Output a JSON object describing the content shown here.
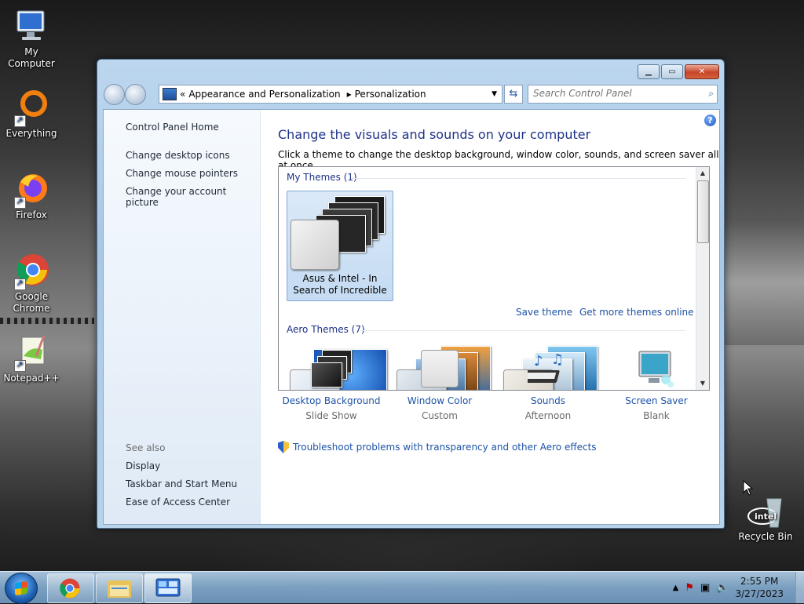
{
  "desktop": {
    "icons": [
      {
        "label": "My Computer"
      },
      {
        "label": "Everything"
      },
      {
        "label": "Firefox"
      },
      {
        "label": "Google Chrome"
      },
      {
        "label": "Notepad++"
      },
      {
        "label": "Recycle Bin"
      }
    ]
  },
  "window": {
    "address": {
      "sep": "«",
      "segments": [
        "Appearance and Personalization",
        "Personalization"
      ],
      "nav_sep": "▸"
    },
    "search": {
      "placeholder": "Search Control Panel"
    },
    "left": {
      "home": "Control Panel Home",
      "tasks": [
        "Change desktop icons",
        "Change mouse pointers",
        "Change your account picture"
      ],
      "see_also_heading": "See also",
      "see_also": [
        "Display",
        "Taskbar and Start Menu",
        "Ease of Access Center"
      ]
    },
    "main": {
      "heading": "Change the visuals and sounds on your computer",
      "description": "Click a theme to change the desktop background, window color, sounds, and screen saver all at once.",
      "my_themes_header": "My Themes (1)",
      "my_theme_name_line1": "Asus & Intel - In",
      "my_theme_name_line2": "Search of Incredible",
      "save_theme": "Save theme",
      "get_more": "Get more themes online",
      "aero_themes_header": "Aero Themes (7)",
      "bottom": [
        {
          "title": "Desktop Background",
          "subtitle": "Slide Show"
        },
        {
          "title": "Window Color",
          "subtitle": "Custom"
        },
        {
          "title": "Sounds",
          "subtitle": "Afternoon"
        },
        {
          "title": "Screen Saver",
          "subtitle": "Blank"
        }
      ],
      "troubleshoot": "Troubleshoot problems with transparency and other Aero effects"
    }
  },
  "taskbar": {
    "time": "2:55 PM",
    "date": "3/27/2023"
  }
}
